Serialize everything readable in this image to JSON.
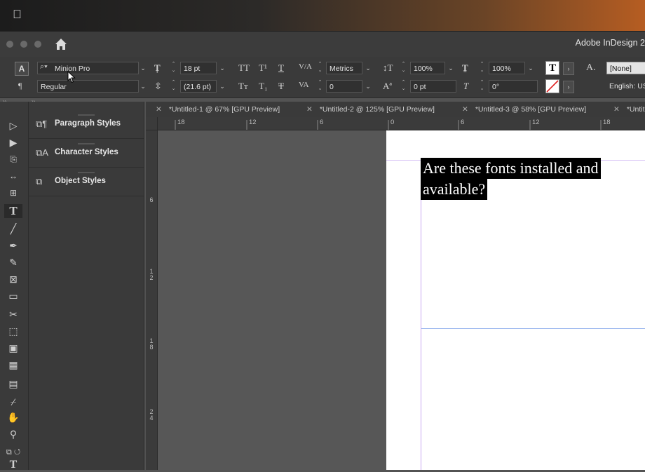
{
  "menubar": {
    "apple": ""
  },
  "window": {
    "app_title": "Adobe InDesign 2"
  },
  "control_panel": {
    "font_family": "Minion Pro",
    "font_style": "Regular",
    "font_size": "18 pt",
    "leading": "(21.6 pt)",
    "kerning": "Metrics",
    "tracking": "0",
    "vertical_scale": "100%",
    "horizontal_scale": "100%",
    "baseline_shift": "0 pt",
    "skew": "0°",
    "character_style": "[None]",
    "language": "English: US"
  },
  "tabs": [
    {
      "label": "*Untitled-1 @ 67% [GPU Preview]"
    },
    {
      "label": "*Untitled-2 @ 125% [GPU Preview]"
    },
    {
      "label": "*Untitled-3 @ 58% [GPU Preview]"
    },
    {
      "label": "*Untit"
    }
  ],
  "panels": [
    {
      "label": "Paragraph Styles",
      "icon": "paragraph-styles-icon"
    },
    {
      "label": "Character Styles",
      "icon": "character-styles-icon"
    },
    {
      "label": "Object Styles",
      "icon": "object-styles-icon"
    }
  ],
  "rulers": {
    "horizontal": [
      "18",
      "12",
      "6",
      "0",
      "6",
      "12",
      "18"
    ],
    "vertical": [
      "6",
      "1\n2",
      "1\n8",
      "2\n4"
    ]
  },
  "document": {
    "text_line1": "Are these fonts installed and",
    "text_line2": "available?"
  }
}
